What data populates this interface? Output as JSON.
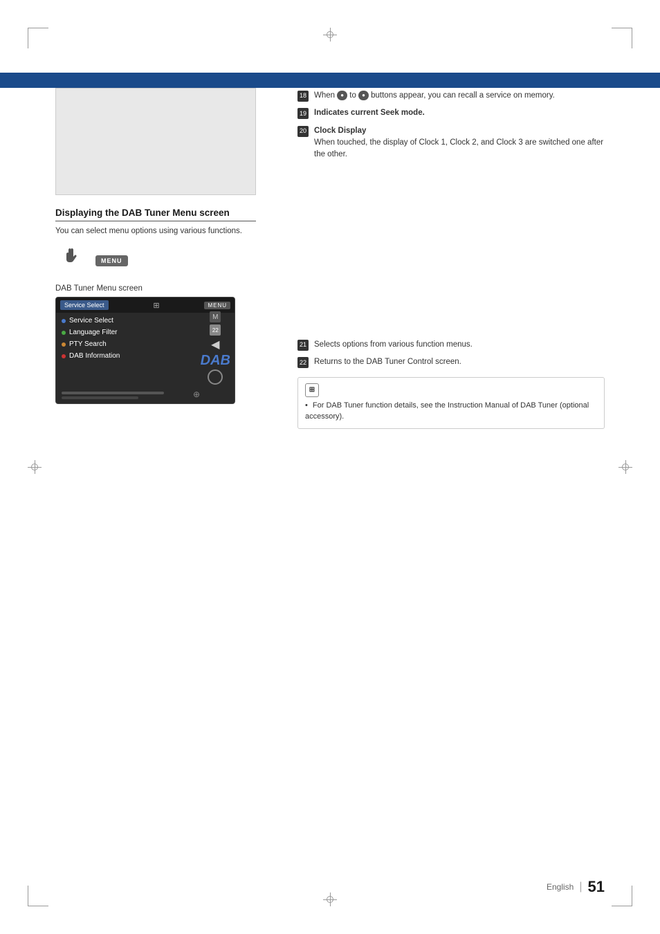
{
  "page": {
    "number": "51",
    "language": "English"
  },
  "header_bar": {
    "color": "#1a4a8a"
  },
  "right_col_top": {
    "items": [
      {
        "num": "18",
        "text_parts": [
          "When ",
          "BUTTON_A",
          " to ",
          "BUTTON_B",
          " buttons appear, you can recall a service on memory."
        ]
      },
      {
        "num": "19",
        "text": "Indicates current Seek mode."
      },
      {
        "num": "20",
        "label": "Clock Display",
        "desc": "When touched, the display of Clock 1, Clock 2, and Clock 3 are switched one after the other."
      }
    ]
  },
  "section": {
    "heading": "Displaying the DAB Tuner Menu screen",
    "description": "You can select menu options using various functions.",
    "screen_label": "DAB Tuner Menu screen"
  },
  "dab_screen": {
    "menu_items": [
      {
        "color": "blue",
        "label": "Service Select"
      },
      {
        "color": "green",
        "label": "Language Filter"
      },
      {
        "color": "orange",
        "label": "PTY Search"
      },
      {
        "color": "red",
        "label": "DAB Information"
      }
    ],
    "dab_label": "DAB",
    "num_badge": "22"
  },
  "right_col_bottom": {
    "items": [
      {
        "num": "21",
        "text": "Selects options from various function menus."
      },
      {
        "num": "22",
        "text": "Returns to the DAB Tuner Control screen."
      }
    ]
  },
  "info_box": {
    "bullet": "For DAB Tuner function details, see the Instruction Manual of DAB Tuner (optional accessory)."
  }
}
